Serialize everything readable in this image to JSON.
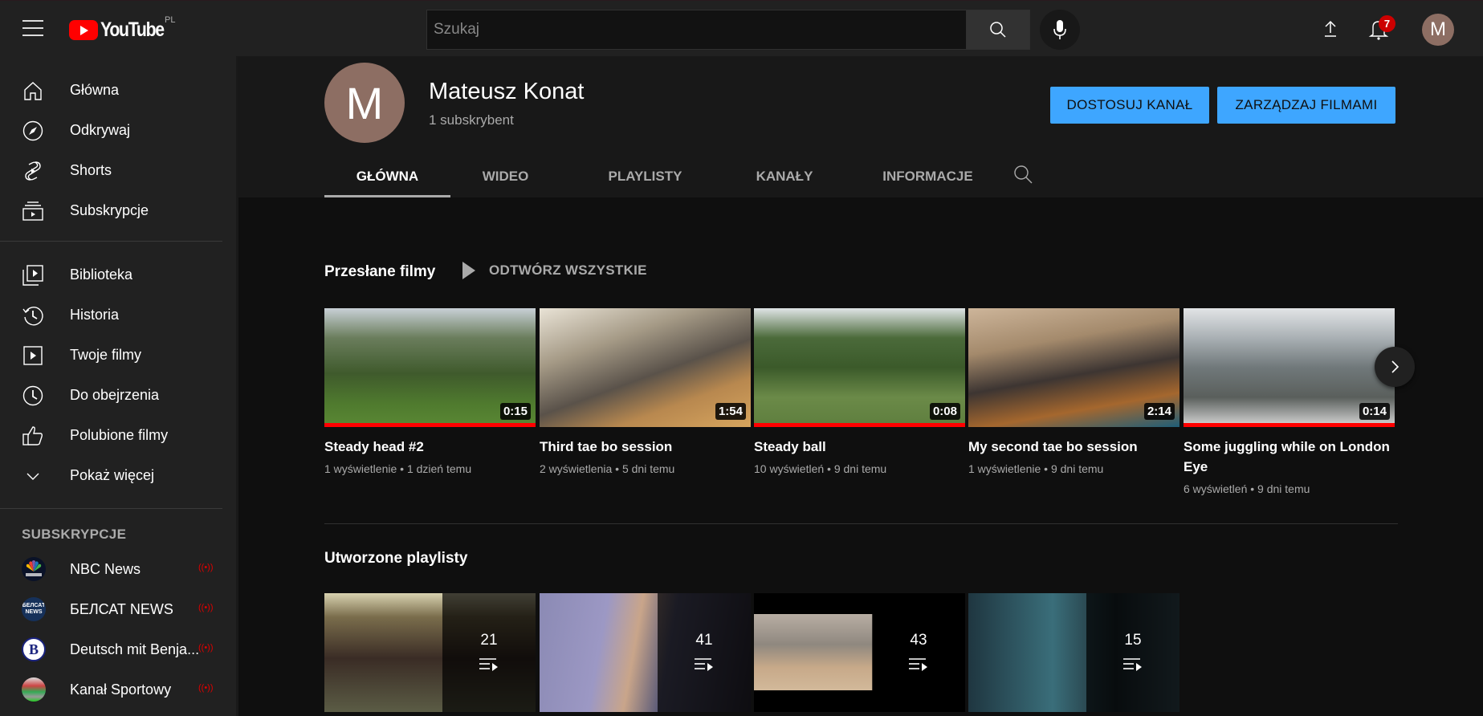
{
  "header": {
    "logo_text": "YouTube",
    "region": "PL",
    "search_placeholder": "Szukaj",
    "notifications_count": "7",
    "avatar_letter": "M"
  },
  "sidebar": {
    "main_items": [
      {
        "label": "Główna",
        "icon": "home-icon"
      },
      {
        "label": "Odkrywaj",
        "icon": "compass-icon"
      },
      {
        "label": "Shorts",
        "icon": "shorts-icon"
      },
      {
        "label": "Subskrypcje",
        "icon": "subscriptions-icon"
      }
    ],
    "library_items": [
      {
        "label": "Biblioteka",
        "icon": "library-icon"
      },
      {
        "label": "Historia",
        "icon": "history-icon"
      },
      {
        "label": "Twoje filmy",
        "icon": "your-videos-icon"
      },
      {
        "label": "Do obejrzenia",
        "icon": "watch-later-icon"
      },
      {
        "label": "Polubione filmy",
        "icon": "thumbs-up-icon"
      },
      {
        "label": "Pokaż więcej",
        "icon": "chevron-down-icon"
      }
    ],
    "subscriptions_title": "SUBSKRYPCJE",
    "subscriptions": [
      {
        "name": "NBC News",
        "avatar_text": "NBC NEWS",
        "live": true
      },
      {
        "name": "БЕЛСАТ NEWS",
        "avatar_text": "БЕЛСАТ NEWS",
        "live": true
      },
      {
        "name": "Deutsch mit Benja...",
        "avatar_text": "B",
        "live": true
      },
      {
        "name": "Kanał Sportowy",
        "avatar_text": "",
        "live": true
      }
    ],
    "live_symbol": "((•))"
  },
  "channel": {
    "avatar_letter": "M",
    "name": "Mateusz Konat",
    "subscribers": "1 subskrybent",
    "customize_button": "DOSTOSUJ KANAŁ",
    "manage_button": "ZARZĄDZAJ FILMAMI",
    "tabs": [
      {
        "label": "GŁÓWNA",
        "active": true
      },
      {
        "label": "WIDEO",
        "active": false
      },
      {
        "label": "PLAYLISTY",
        "active": false
      },
      {
        "label": "KANAŁY",
        "active": false
      },
      {
        "label": "INFORMACJE",
        "active": false
      }
    ]
  },
  "uploads": {
    "title": "Przesłane filmy",
    "play_all": "ODTWÓRZ WSZYSTKIE",
    "videos": [
      {
        "title": "Steady head #2",
        "duration": "0:15",
        "meta": "1 wyświetlenie • 1 dzień temu",
        "watched_fraction": 1.0
      },
      {
        "title": "Third tae bo session",
        "duration": "1:54",
        "meta": "2 wyświetlenia • 5 dni temu",
        "watched_fraction": 0
      },
      {
        "title": "Steady ball",
        "duration": "0:08",
        "meta": "10 wyświetleń • 9 dni temu",
        "watched_fraction": 1.0
      },
      {
        "title": "My second tae bo session",
        "duration": "2:14",
        "meta": "1 wyświetlenie • 9 dni temu",
        "watched_fraction": 0
      },
      {
        "title": "Some juggling while on London Eye",
        "duration": "0:14",
        "meta": "6 wyświetleń • 9 dni temu",
        "watched_fraction": 1.0
      }
    ]
  },
  "playlists": {
    "title": "Utworzone playlisty",
    "items": [
      {
        "count": "21"
      },
      {
        "count": "41"
      },
      {
        "count": "43"
      },
      {
        "count": "15"
      }
    ]
  },
  "colors": {
    "accent_blue": "#3ea6ff",
    "brand_red": "#ff0000",
    "badge_red": "#cc0000"
  }
}
